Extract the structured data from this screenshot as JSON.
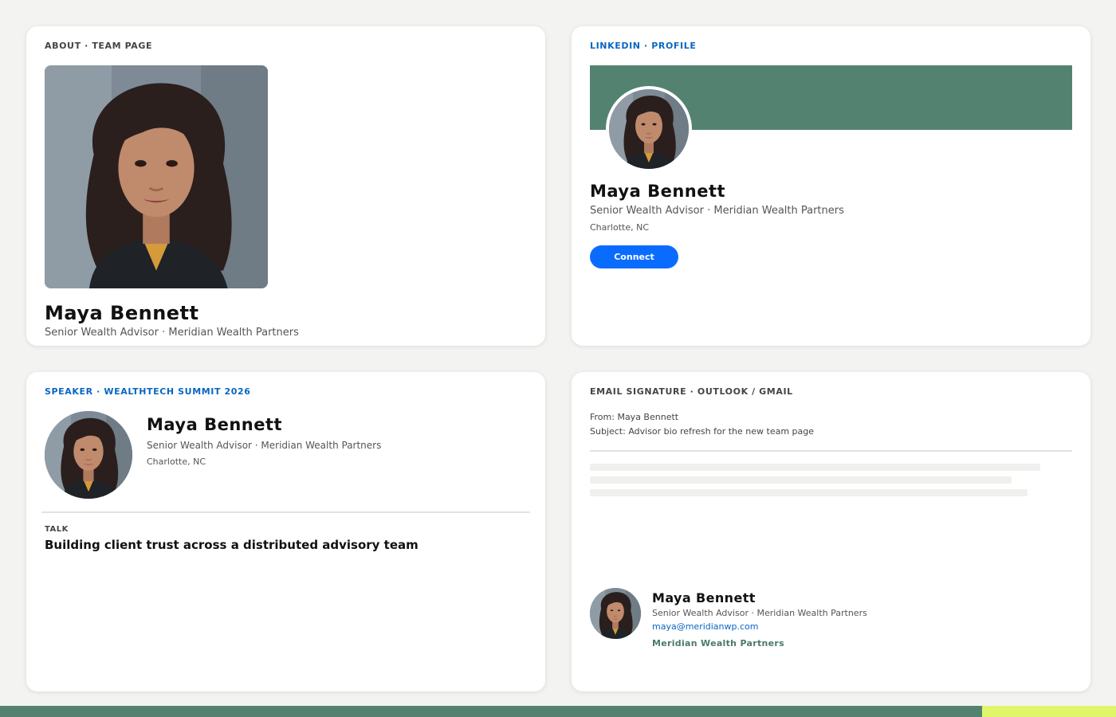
{
  "person": {
    "name": "Maya Bennett",
    "role": "Senior Wealth Advisor · Meridian Wealth Partners",
    "location": "Charlotte, NC"
  },
  "team_card": {
    "eyebrow": "ABOUT · TEAM PAGE"
  },
  "linkedin_card": {
    "eyebrow": "LINKEDIN · PROFILE",
    "connect_label": "Connect",
    "banner_color": "#548271",
    "button_color": "#0a6cff"
  },
  "speaker_card": {
    "eyebrow": "SPEAKER · WEALTHTECH SUMMIT 2026",
    "talk_label": "TALK",
    "talk_title": "Building client trust across a distributed advisory team"
  },
  "email_card": {
    "eyebrow": "EMAIL SIGNATURE · OUTLOOK / GMAIL",
    "from_line": "From: Maya Bennett",
    "subject_line": "Subject: Advisor bio refresh for the new team page",
    "email": "maya@meridianwp.com",
    "company": "Meridian Wealth Partners"
  },
  "colors": {
    "brand_green": "#548271",
    "accent_lime": "#e1f56b",
    "link_blue": "#0a66c2"
  },
  "icons": {
    "portrait": "person-portrait"
  }
}
